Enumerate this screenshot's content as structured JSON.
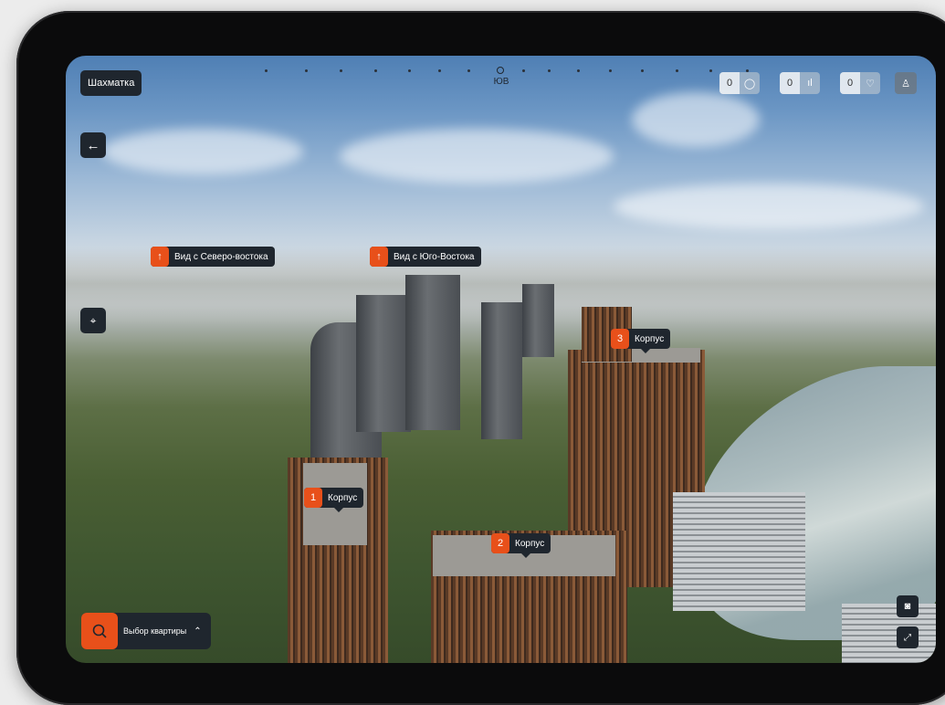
{
  "toolbar": {
    "shakhmatka_label": "Шахматка",
    "back_icon": "←",
    "map_pin_icon": "⌖"
  },
  "compass": {
    "direction_label": "ЮВ"
  },
  "counters": [
    {
      "value": "0",
      "icon": "◯",
      "icon_name": "chat-icon"
    },
    {
      "value": "0",
      "icon": "ıl",
      "icon_name": "compare-icon"
    },
    {
      "value": "0",
      "icon": "♡",
      "icon_name": "heart-icon"
    }
  ],
  "profile_icon": "♙",
  "view_tags": [
    {
      "arrow": "↑",
      "label": "Вид с Северо-востока"
    },
    {
      "arrow": "↑",
      "label": "Вид с Юго-Востока"
    }
  ],
  "building_tags": [
    {
      "number": "1",
      "label": "Корпус"
    },
    {
      "number": "2",
      "label": "Корпус"
    },
    {
      "number": "3",
      "label": "Корпус"
    }
  ],
  "search": {
    "icon": "○",
    "label": "Выбор квартиры",
    "chevron": "⌃"
  },
  "camera_icon": "◙",
  "fullscreen_icon": "⤢",
  "colors": {
    "accent": "#e8501a",
    "dark": "#1f262e"
  }
}
